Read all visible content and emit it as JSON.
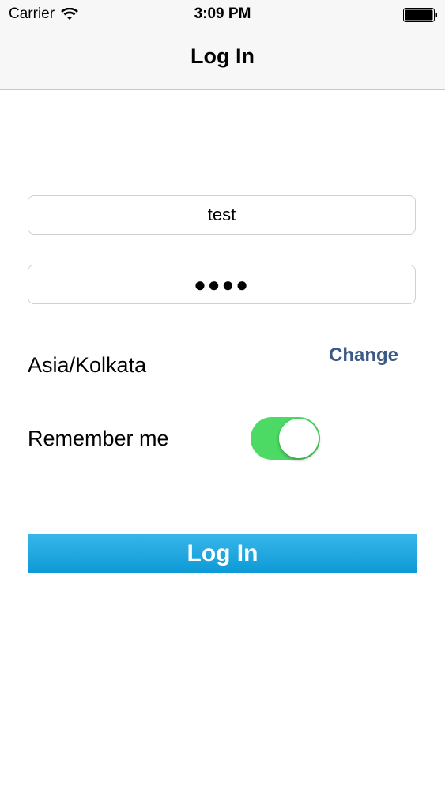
{
  "status_bar": {
    "carrier": "Carrier",
    "time": "3:09 PM",
    "wifi_icon": "wifi-icon",
    "battery_icon": "battery-icon"
  },
  "nav": {
    "title": "Log In"
  },
  "form": {
    "username_value": "test",
    "password_value": "●●●●",
    "timezone": "Asia/Kolkata",
    "change_label": "Change",
    "remember_label": "Remember me",
    "remember_on": true,
    "login_label": "Log In"
  },
  "colors": {
    "accent_link": "#3c5a87",
    "toggle_on": "#4cd964",
    "button_top": "#38b6e9",
    "button_bottom": "#0d9ad6"
  }
}
